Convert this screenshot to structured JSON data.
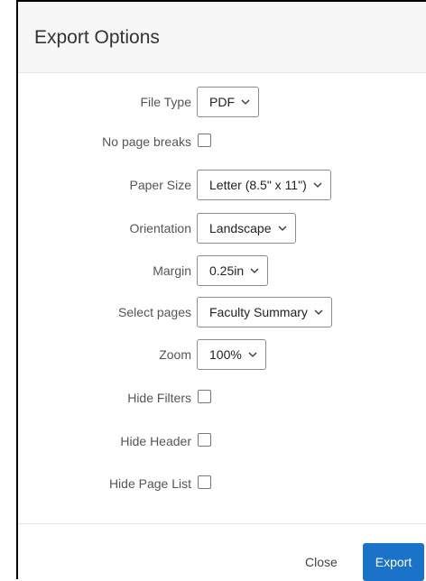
{
  "dialog": {
    "title": "Export Options"
  },
  "fields": {
    "file_type": {
      "label": "File Type",
      "value": "PDF"
    },
    "no_page_breaks": {
      "label": "No page breaks",
      "checked": false
    },
    "paper_size": {
      "label": "Paper Size",
      "value": "Letter (8.5\" x 11\")"
    },
    "orientation": {
      "label": "Orientation",
      "value": "Landscape"
    },
    "margin": {
      "label": "Margin",
      "value": "0.25in"
    },
    "select_pages": {
      "label": "Select pages",
      "value": "Faculty Summary"
    },
    "zoom": {
      "label": "Zoom",
      "value": "100%"
    },
    "hide_filters": {
      "label": "Hide Filters",
      "checked": false
    },
    "hide_header": {
      "label": "Hide Header",
      "checked": false
    },
    "hide_page_list": {
      "label": "Hide Page List",
      "checked": false
    }
  },
  "footer": {
    "close_label": "Close",
    "export_label": "Export"
  },
  "colors": {
    "primary": "#1a73c9",
    "title_bar": "#f7f7f7"
  },
  "icons": {
    "dropdown": "chevron-down-icon"
  }
}
